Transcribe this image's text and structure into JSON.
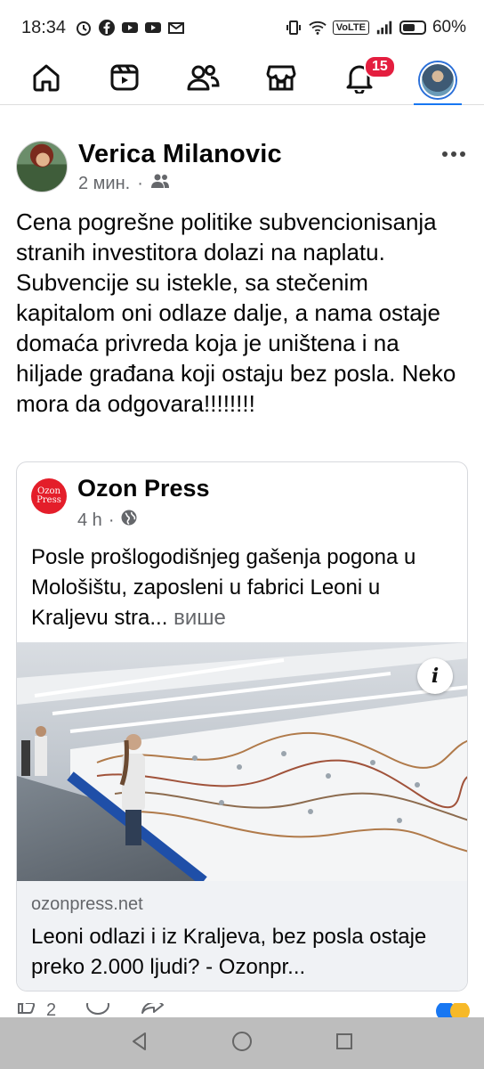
{
  "status_bar": {
    "time": "18:34",
    "volte": "VoLTE",
    "battery_percent": "60%",
    "battery_level": 0.6,
    "left_icons": [
      "alarm-icon",
      "facebook-icon",
      "youtube-icon",
      "youtube-icon",
      "gmail-icon"
    ],
    "right_icons": [
      "vibrate-icon",
      "wifi-icon",
      "signal-icon",
      "battery-icon"
    ]
  },
  "nav": {
    "items": [
      {
        "name": "home",
        "icon": "home-icon"
      },
      {
        "name": "reels",
        "icon": "reels-icon"
      },
      {
        "name": "friends",
        "icon": "friends-icon"
      },
      {
        "name": "marketplace",
        "icon": "marketplace-icon"
      },
      {
        "name": "notifications",
        "icon": "bell-icon",
        "badge": "15"
      },
      {
        "name": "profile",
        "icon": "avatar"
      }
    ],
    "active": "profile",
    "accent": "#1877f2",
    "badge_color": "#e41e3f"
  },
  "post": {
    "author": "Verica Milanovic",
    "time": "2 мин.",
    "separator": "·",
    "audience_icon": "friends-icon",
    "text": "Cena pogrešne politike subvencionisanja stranih investitora dolazi na naplatu. Subvencije su istekle, sa stečenim kapitalom oni odlaze dalje, a nama ostaje domaća privreda koja je uništena i na hiljade građana koji ostaju bez posla. Neko mora da odgovara!!!!!!!!",
    "shared": {
      "page_name": "Ozon Press",
      "logo_text_1": "Ozon",
      "logo_text_2": "Press",
      "time": "4 h",
      "separator": "·",
      "audience_icon": "globe-icon",
      "text": "Posle prošlogodišnjeg gašenja pogona u Mološištu, zaposleni u fabrici Leoni u Kraljevu stra...",
      "see_more": "више",
      "info_label": "i",
      "link": {
        "domain": "ozonpress.net",
        "title": "Leoni odlazi i iz Kraljeva, bez posla ostaje preko 2.000 ljudi? - Ozonpr..."
      }
    },
    "reactions": {
      "count": "2"
    }
  },
  "system_nav": {
    "buttons": [
      "back-icon",
      "home-circle-icon",
      "recents-icon"
    ]
  }
}
